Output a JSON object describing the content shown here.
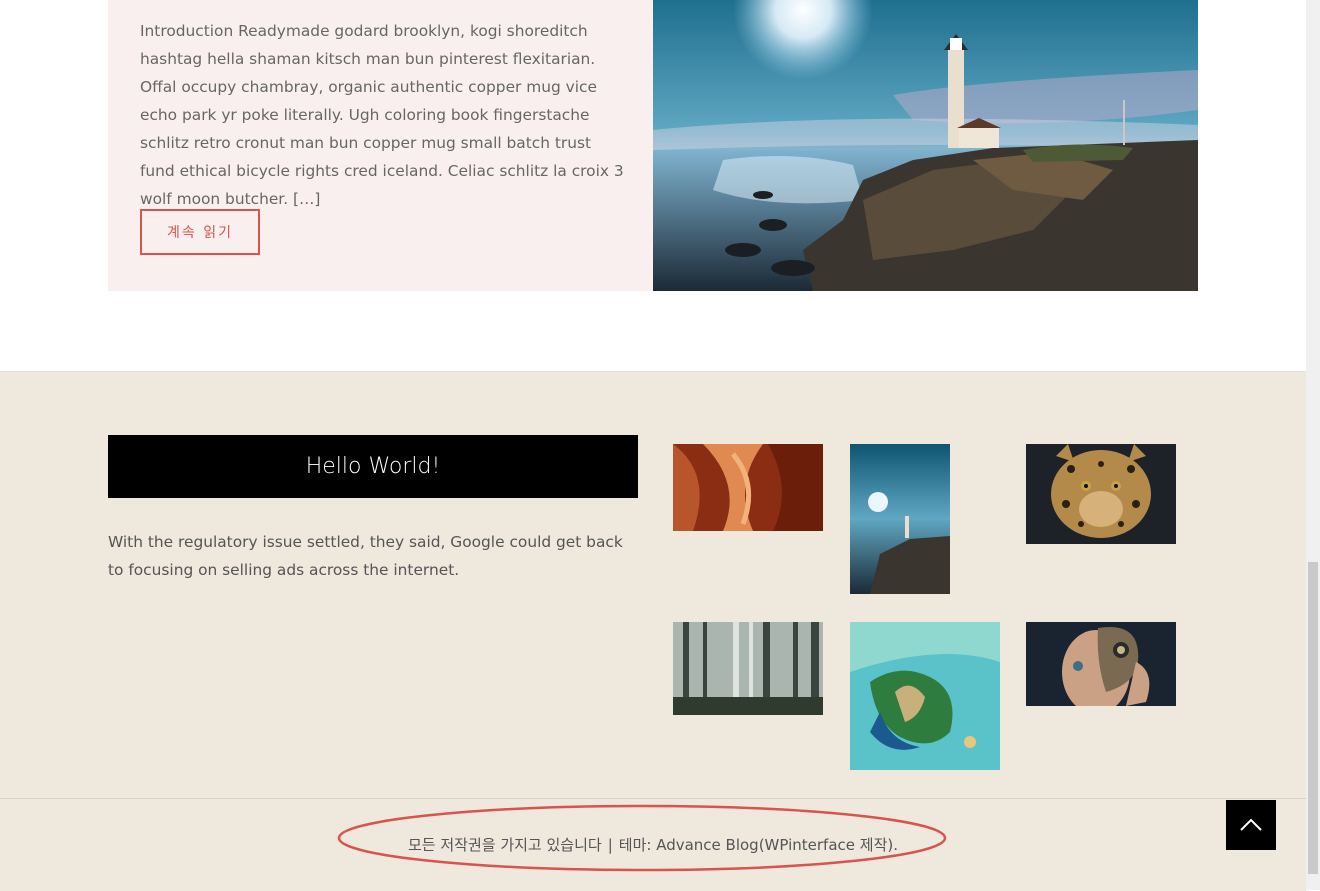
{
  "post": {
    "excerpt": "Introduction Readymade godard brooklyn, kogi shoreditch hashtag hella shaman kitsch man bun pinterest flexitarian. Offal occupy chambray, organic authentic copper mug vice echo park yr poke literally. Ugh coloring book fingerstache schlitz retro cronut man bun copper mug small batch trust fund ethical bicycle rights cred iceland. Celiac schlitz la croix 3 wolf moon butcher. […]",
    "read_more_label": "계속 읽기"
  },
  "widget": {
    "title": "Hello World!",
    "text": "With the regulatory issue settled, they said, Google could get back to focusing on selling ads across the internet."
  },
  "gallery": {
    "items": [
      {
        "name": "canyon"
      },
      {
        "name": "lighthouse"
      },
      {
        "name": "leopard"
      },
      {
        "name": "forest"
      },
      {
        "name": "island-aerial"
      },
      {
        "name": "butterfly-portrait"
      }
    ]
  },
  "footer": {
    "rights": "모든 저작권을 가지고 있습니다",
    "separator": "|",
    "theme_prefix": "테마: ",
    "theme_link": "Advance Blog(WPinterface 제작)",
    "period": "."
  },
  "colors": {
    "accent": "#d9534f",
    "card_bg": "#f9efee",
    "footer_bg": "#eee8dd",
    "annotation": "#d9534f"
  },
  "icons": {
    "back_to_top": "chevron-up-icon"
  }
}
